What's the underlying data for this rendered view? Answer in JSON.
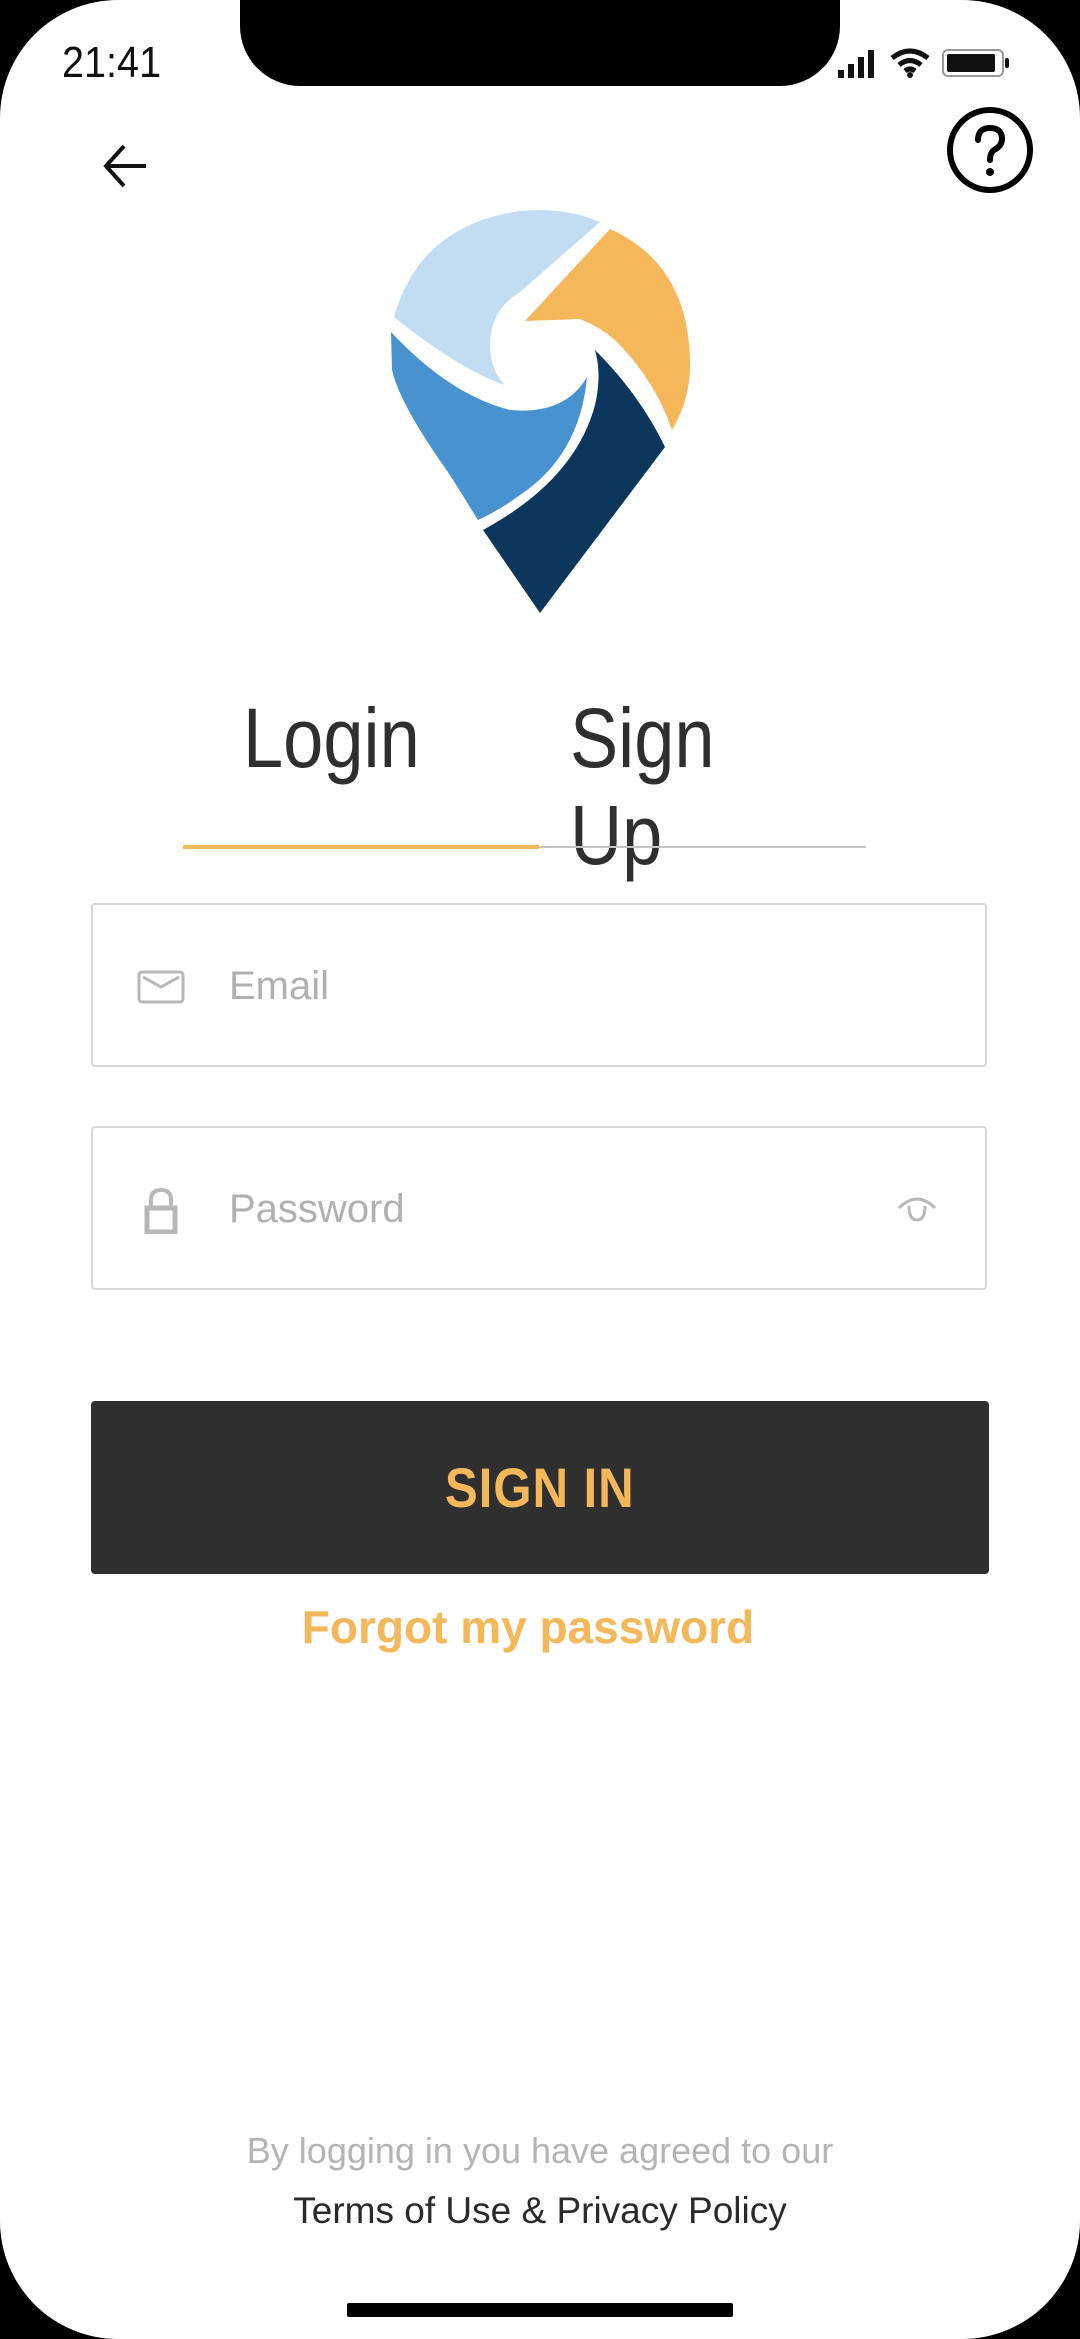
{
  "status_bar": {
    "time": "21:41",
    "icons": [
      "cellular-signal-icon",
      "wifi-icon",
      "battery-icon"
    ]
  },
  "header": {
    "back_icon": "arrow-left-icon",
    "help_icon": "question-circle-icon"
  },
  "logo": {
    "name": "map-pin-swirl-logo",
    "colors": {
      "light_blue": "#c2ddf2",
      "orange": "#f4b75a",
      "mid_blue": "#4893cf",
      "navy": "#0c365b"
    }
  },
  "tabs": [
    {
      "label": "Login",
      "active": true
    },
    {
      "label": "Sign Up",
      "active": false
    }
  ],
  "form": {
    "email": {
      "placeholder": "Email",
      "value": "",
      "icon": "envelope-icon"
    },
    "password": {
      "placeholder": "Password",
      "value": "",
      "icon": "lock-icon",
      "toggle_icon": "eye-icon"
    },
    "submit_label": "SIGN IN",
    "forgot_label": "Forgot my password"
  },
  "footer": {
    "agree_text": "By logging in you have agreed to our",
    "terms_link": "Terms of Use & Privacy Policy"
  },
  "colors": {
    "accent": "#f4b75a",
    "button_bg": "#2f2f2f",
    "tab_text": "#2f2f2f",
    "placeholder": "#b0b0b0",
    "border": "#d6d6d6"
  }
}
